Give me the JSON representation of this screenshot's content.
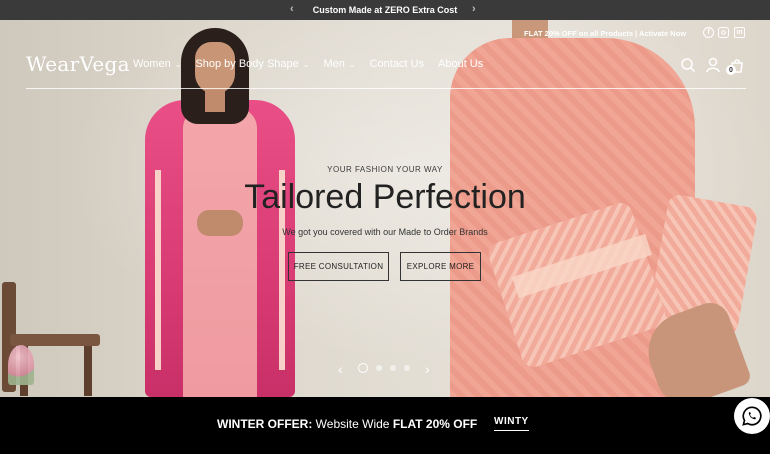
{
  "announcement": {
    "text": "Custom Made at ZERO Extra Cost"
  },
  "header": {
    "flat_offer": "FLAT 20% OFF on all Products | Activate Now",
    "logo": "WearVega",
    "nav": [
      {
        "label": "Women",
        "dropdown": true
      },
      {
        "label": "Shop by Body Shape",
        "dropdown": true
      },
      {
        "label": "Men",
        "dropdown": true
      },
      {
        "label": "Contact Us",
        "dropdown": false
      },
      {
        "label": "About Us",
        "dropdown": false
      }
    ],
    "cart_count": "0",
    "social_icons": [
      "facebook-icon",
      "instagram-icon",
      "linkedin-icon"
    ]
  },
  "hero": {
    "eyebrow": "YOUR FASHION YOUR WAY",
    "headline": "Tailored Perfection",
    "subline": "We got you covered with our Made to Order Brands",
    "cta_primary": "FREE CONSULTATION",
    "cta_secondary": "EXPLORE MORE",
    "slide_count": 4,
    "active_slide": 1
  },
  "offer_bar": {
    "label": "WINTER OFFER:",
    "text_mid": " Website Wide ",
    "highlight": "FLAT 20% OFF",
    "code": "WINTY"
  },
  "colors": {
    "announce_bg": "#3a3a3a",
    "offer_bg": "#000000",
    "accent_pink": "#e94f86"
  }
}
